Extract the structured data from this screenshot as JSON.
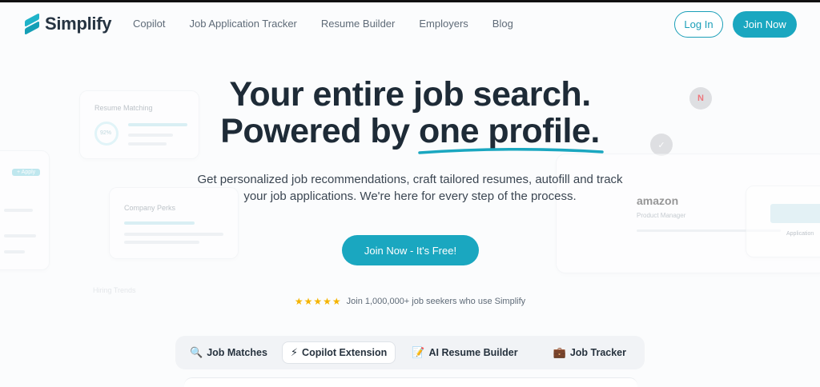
{
  "brand": {
    "name": "Simplify",
    "accent": "#1aa7c0"
  },
  "nav": {
    "links": [
      "Copilot",
      "Job Application Tracker",
      "Resume Builder",
      "Employers",
      "Blog"
    ],
    "login_label": "Log In",
    "join_label": "Join Now"
  },
  "hero": {
    "title_line1": "Your entire job search.",
    "title_line2_prefix": "Powered by ",
    "title_line2_highlight": "one profile.",
    "subtitle_line1": "Get personalized job recommendations, craft tailored resumes, autofill and track",
    "subtitle_line2": "your job applications. We're here for every step of the process.",
    "cta_label": "Join Now - It's Free!"
  },
  "social_proof": {
    "stars": "★★★★★",
    "text": "Join 1,000,000+ job seekers who use Simplify"
  },
  "background_cards": {
    "resume_matching": {
      "title": "Resume Matching",
      "score": "92%"
    },
    "company_perks": {
      "title": "Company Perks"
    },
    "apply_badge": "+ Apply",
    "hiring_trends": "Hiring Trends",
    "amazon": {
      "company": "amazon",
      "role": "Product Manager"
    },
    "application": "Application"
  },
  "feature_tabs": [
    {
      "icon": "🔍",
      "icon_name": "magnifier-icon",
      "label": "Job Matches"
    },
    {
      "icon": "⚡",
      "icon_name": "lightning-icon",
      "label": "Copilot Extension"
    },
    {
      "icon": "📝",
      "icon_name": "memo-icon",
      "label": "AI Resume Builder"
    },
    {
      "icon": "💼",
      "icon_name": "briefcase-icon",
      "label": "Job Tracker"
    }
  ],
  "active_tab_index": 1
}
